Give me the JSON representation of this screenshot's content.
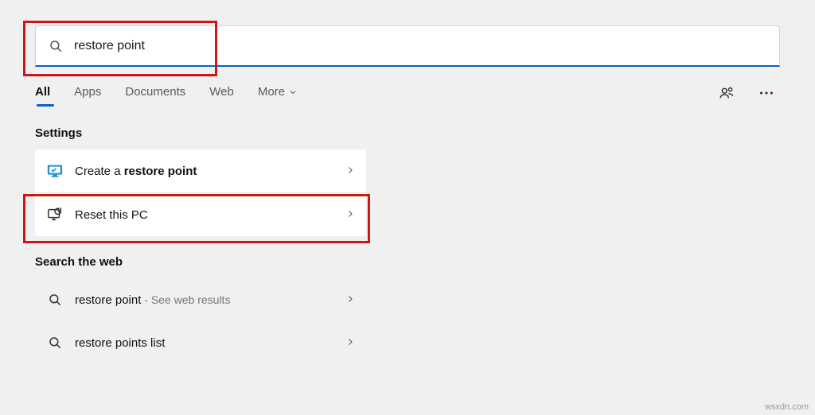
{
  "search": {
    "query": "restore point"
  },
  "tabs": {
    "all": "All",
    "apps": "Apps",
    "documents": "Documents",
    "web": "Web",
    "more": "More"
  },
  "groups": {
    "settings_title": "Settings",
    "web_title": "Search the web"
  },
  "results": {
    "create_restore_prefix": "Create a ",
    "create_restore_bold": "restore point",
    "reset_pc": "Reset this PC",
    "web1_prefix": "restore point",
    "web1_suffix": " - See web results",
    "web2": "restore points list"
  },
  "watermark": "wsxdn.com"
}
